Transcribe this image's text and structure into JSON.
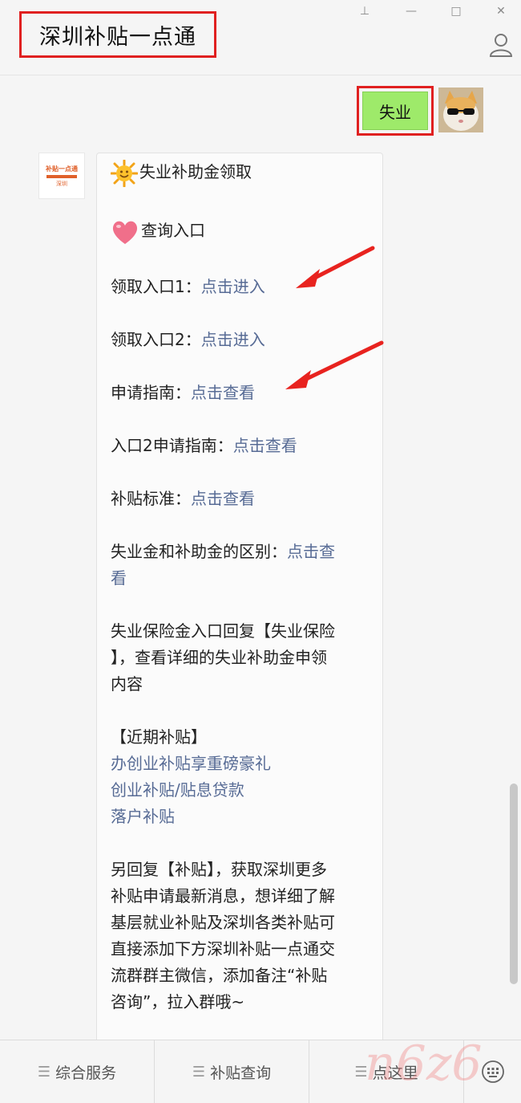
{
  "header": {
    "title": "深圳补贴一点通",
    "pin_glyph": "⊥",
    "minimize_glyph": "—",
    "maximize_glyph": "□",
    "close_glyph": "✕"
  },
  "user_message": {
    "text": "失业"
  },
  "bot_avatar": {
    "line1": "补贴一点通",
    "line2": "深圳"
  },
  "bot_message": {
    "heading": "失业补助金领取",
    "query_heading": "查询入口",
    "entries": [
      {
        "label": "领取入口1：",
        "link": "点击进入"
      },
      {
        "label": "领取入口2：",
        "link": "点击进入"
      },
      {
        "label": "申请指南：",
        "link": "点击查看"
      },
      {
        "label": "入口2申请指南：",
        "link": "点击查看"
      },
      {
        "label": "补贴标准：",
        "link": "点击查看"
      }
    ],
    "difference": {
      "label": "失业金和补助金的区别：",
      "link1": "点击查",
      "link2": "看"
    },
    "insurance_lines": [
      "失业保险金入口回复【失业保险",
      "】，查看详细的失业补助金申领",
      "内容"
    ],
    "recent_heading": "【近期补贴】",
    "recent_links": [
      "办创业补贴享重磅豪礼",
      "创业补贴/贴息贷款",
      "落户补贴"
    ],
    "closing_lines": [
      "另回复【补贴】，获取深圳更多",
      "补贴申请最新消息，想详细了解",
      "基层就业补贴及深圳各类补贴可",
      "直接添加下方深圳补贴一点通交",
      "流群群主微信，添加备注“补贴",
      "咨询”，拉入群哦~"
    ]
  },
  "bottom_menu": {
    "items": [
      "综合服务",
      "补贴查询",
      "点这里"
    ],
    "menu_glyph": "☰"
  },
  "watermark": "n6z6",
  "colors": {
    "link": "#576b95",
    "highlight": "#e02020",
    "user_bubble": "#9eea6a"
  }
}
